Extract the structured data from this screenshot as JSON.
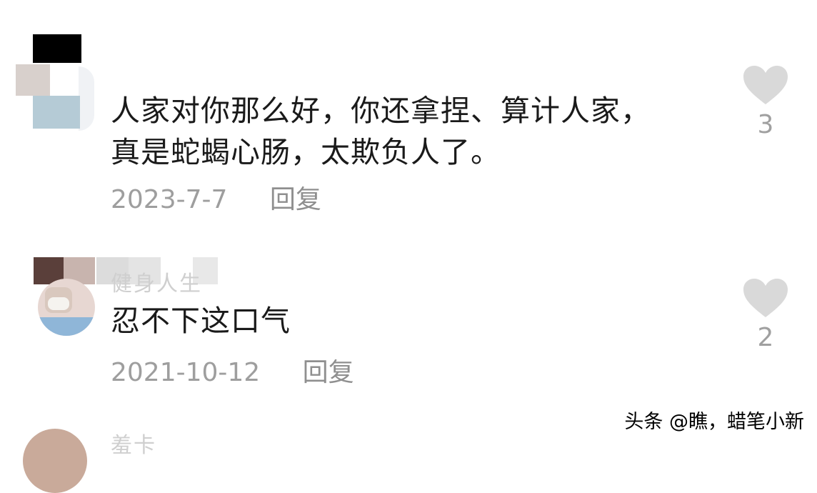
{
  "comments": [
    {
      "username": "",
      "text_line1": "人家对你那么好，你还拿捏、算计人家，",
      "text_line2": "真是蛇蝎心肠，太欺负人了。",
      "date": "2023-7-7",
      "reply_label": "回复",
      "like_count": "3"
    },
    {
      "username": "健身人生",
      "text_line1": "忍不下这口气",
      "date": "2021-10-12",
      "reply_label": "回复",
      "like_count": "2"
    },
    {
      "username": "羞卡"
    }
  ],
  "watermark": "头条 @瞧，蜡笔小新",
  "colors": {
    "like_icon": "#d9d9d9",
    "text": "#1a1a1a",
    "meta": "#9e9e9e"
  }
}
